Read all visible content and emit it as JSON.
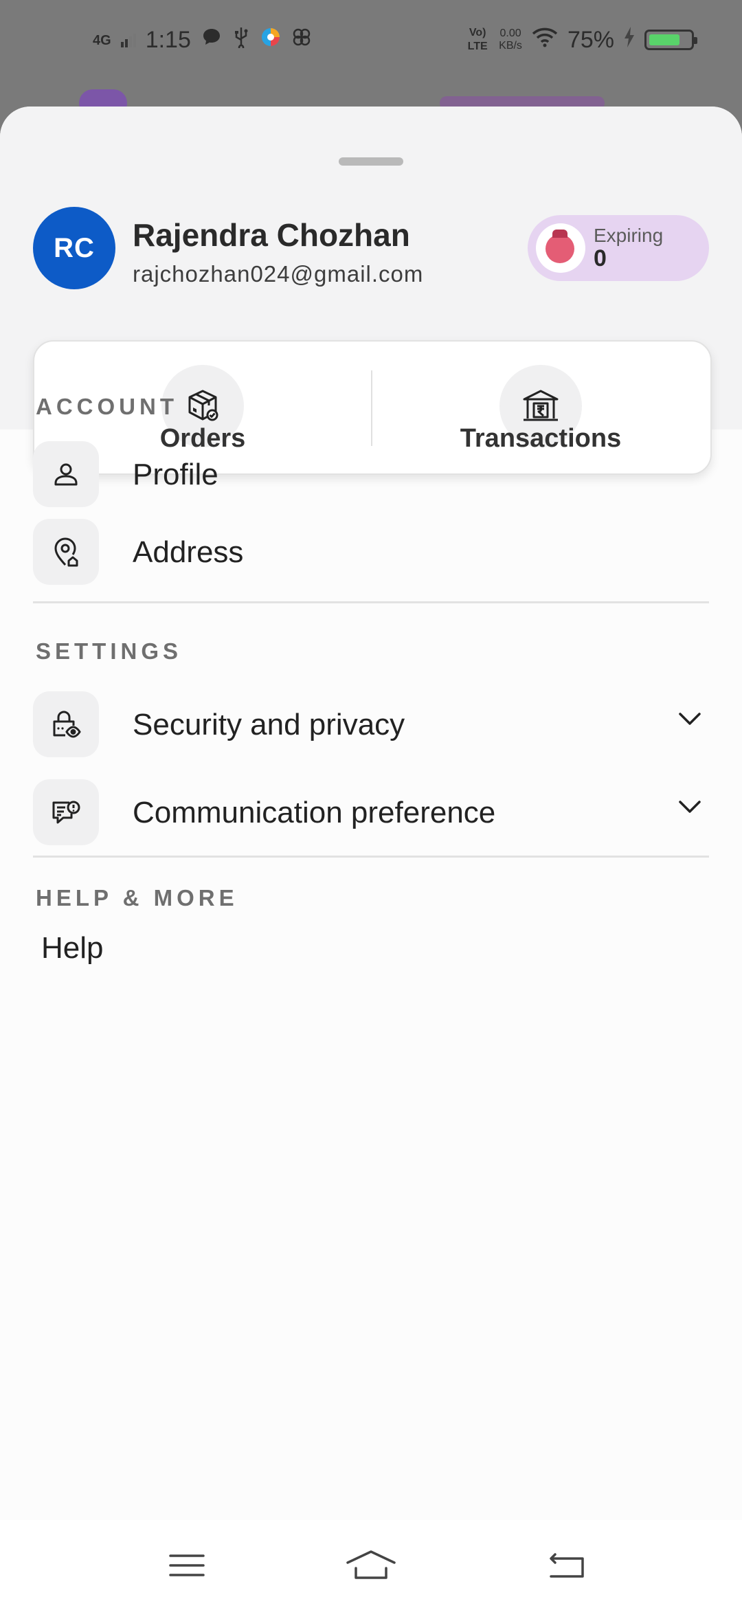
{
  "status_bar": {
    "network": "4G",
    "time": "1:15",
    "volte": "Vo) LTE",
    "data_speed": "0.00",
    "data_unit": "KB/s",
    "battery": "75%",
    "battery_level": 0.75
  },
  "profile": {
    "initials": "RC",
    "name": "Rajendra Chozhan",
    "email": "rajchozhan024@gmail.com",
    "expiring_label": "Expiring",
    "expiring_value": "0"
  },
  "quick_actions": [
    {
      "label": "Orders",
      "icon": "package-icon"
    },
    {
      "label": "Transactions",
      "icon": "bank-rupee-icon"
    }
  ],
  "sections": {
    "account": {
      "title": "ACCOUNT",
      "items": [
        {
          "label": "Profile",
          "icon": "person-icon"
        },
        {
          "label": "Address",
          "icon": "location-home-icon"
        }
      ]
    },
    "settings": {
      "title": "SETTINGS",
      "items": [
        {
          "label": "Security and privacy",
          "icon": "lock-eye-icon"
        },
        {
          "label": "Communication preference",
          "icon": "message-alert-icon"
        }
      ]
    },
    "help": {
      "title": "HELP & MORE",
      "items": [
        {
          "label": "Help"
        }
      ]
    }
  },
  "colors": {
    "avatar": "#0d5bc7",
    "expiring_pill": "#e6d4f1",
    "battery": "#59d36a"
  }
}
